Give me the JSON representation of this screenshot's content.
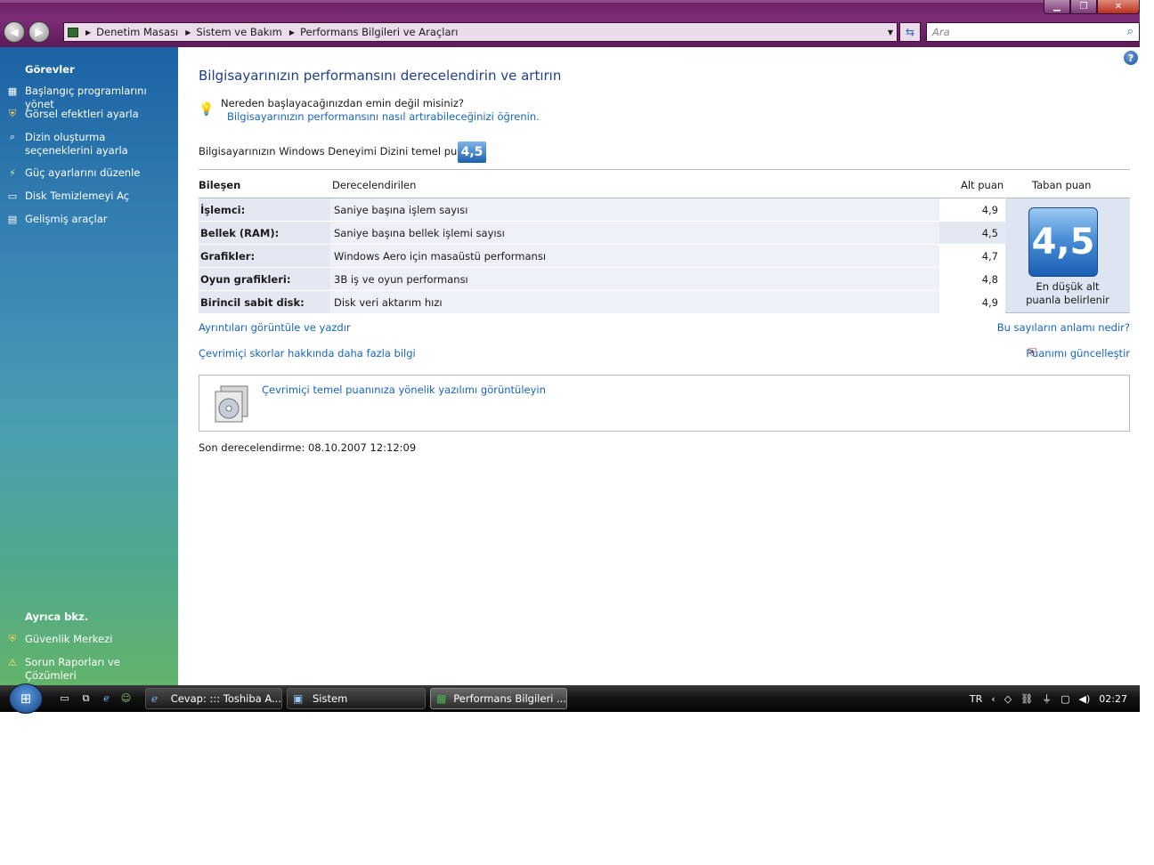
{
  "window": {
    "buttons": {
      "minimize": "▁",
      "maximize": "❐",
      "close": "✕"
    }
  },
  "nav": {
    "back_icon": "◀",
    "forward_icon": "▶",
    "breadcrumb": [
      "Denetim Masası",
      "Sistem ve Bakım",
      "Performans Bilgileri ve Araçları"
    ],
    "search_placeholder": "Ara"
  },
  "sidebar": {
    "tasks_title": "Görevler",
    "tasks": [
      {
        "label": "Başlangıç programlarını yönet",
        "icon": "startup-programs-icon"
      },
      {
        "label": "Görsel efektleri ayarla",
        "icon": "shield-icon"
      },
      {
        "label": "Dizin oluşturma seçeneklerini ayarla",
        "icon": "indexing-icon"
      },
      {
        "label": "Güç ayarlarını düzenle",
        "icon": "power-icon"
      },
      {
        "label": "Disk Temizlemeyi Aç",
        "icon": "disk-cleanup-icon"
      },
      {
        "label": "Gelişmiş araçlar",
        "icon": "advanced-tools-icon"
      }
    ],
    "see_also_title": "Ayrıca bkz.",
    "see_also": [
      {
        "label": "Güvenlik Merkezi",
        "icon": "security-center-icon"
      },
      {
        "label": "Sorun Raporları ve Çözümleri",
        "icon": "problem-reports-icon"
      }
    ]
  },
  "main": {
    "title": "Bilgisayarınızın performansını derecelendirin ve artırın",
    "tip_text": "Nereden başlayacağınızdan emin değil misiniz?",
    "tip_link": "Bilgisayarınızın performansını nasıl artırabileceğinizi öğrenin.",
    "base_score_label": "Bilgisayarınızın Windows Deneyimi Dizini temel puanı:",
    "base_score": "4,5",
    "table": {
      "headers": {
        "component": "Bileşen",
        "rated": "Derecelendirilen",
        "subscore": "Alt puan",
        "basescore": "Taban puan"
      },
      "rows": [
        {
          "component": "İşlemci:",
          "rated": "Saniye başına işlem sayısı",
          "subscore": "4,9"
        },
        {
          "component": "Bellek (RAM):",
          "rated": "Saniye başına bellek işlemi sayısı",
          "subscore": "4,5"
        },
        {
          "component": "Grafikler:",
          "rated": "Windows Aero için masaüstü performansı",
          "subscore": "4,7"
        },
        {
          "component": "Oyun grafikleri:",
          "rated": "3B iş ve oyun performansı",
          "subscore": "4,8"
        },
        {
          "component": "Birincil sabit disk:",
          "rated": "Disk veri aktarım hızı",
          "subscore": "4,9"
        }
      ],
      "big_score": "4,5",
      "big_caption_1": "En düşük alt",
      "big_caption_2": "puanla belirlenir"
    },
    "links": {
      "details": "Ayrıntıları görüntüle ve yazdır",
      "meaning": "Bu sayıların anlamı nedir?",
      "online": "Çevrimiçi skorlar hakkında daha fazla bilgi",
      "update": "Puanımı güncelleştir"
    },
    "software_link": "Çevrimiçi temel puanınıza yönelik yazılımı görüntüleyin",
    "last_rated": "Son derecelendirme: 08.10.2007 12:12:09"
  },
  "taskbar": {
    "tasks": [
      {
        "label": "Cevap: ::: Toshiba A...",
        "icon": "internet-explorer-icon"
      },
      {
        "label": "Sistem",
        "icon": "system-icon"
      },
      {
        "label": "Performans Bilgileri ...",
        "icon": "performance-icon"
      }
    ],
    "language": "TR",
    "time": "02:27"
  }
}
